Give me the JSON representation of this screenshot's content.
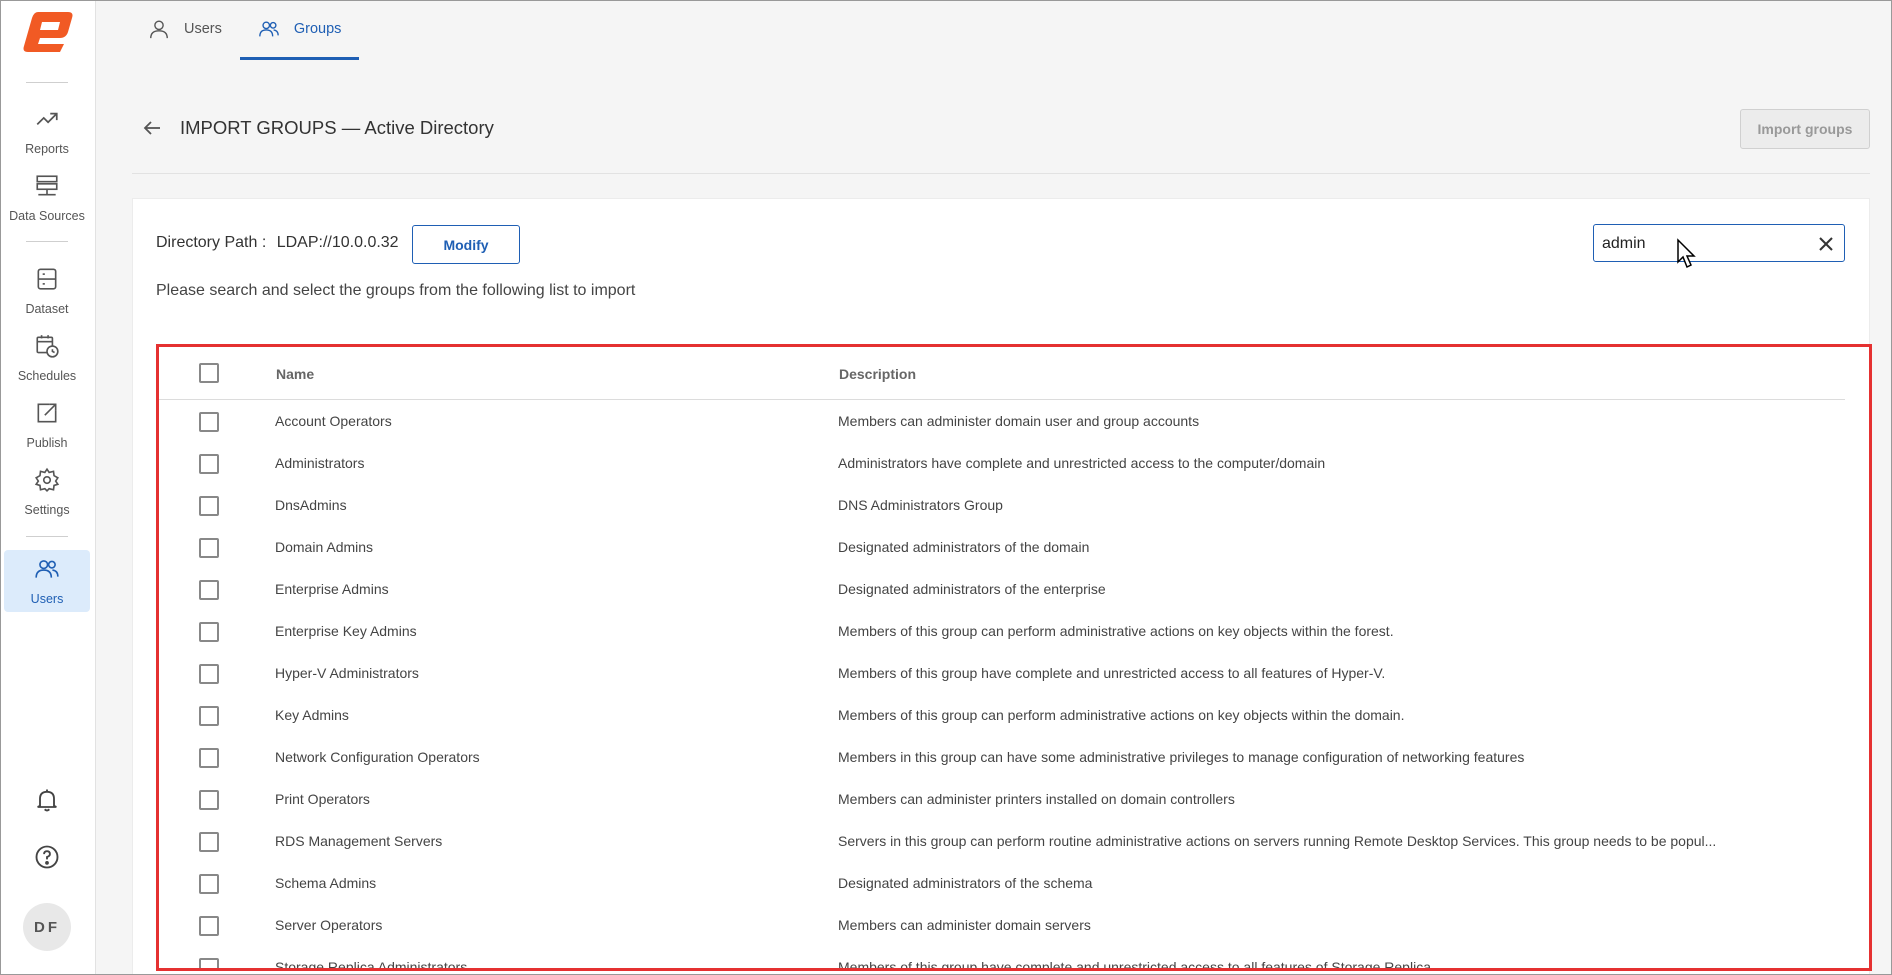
{
  "sidebar": {
    "items": [
      {
        "label": "Reports"
      },
      {
        "label": "Data Sources"
      },
      {
        "label": "Dataset"
      },
      {
        "label": "Schedules"
      },
      {
        "label": "Publish"
      },
      {
        "label": "Settings"
      },
      {
        "label": "Users"
      }
    ],
    "avatar_initials": "DF"
  },
  "tabs": [
    {
      "label": "Users"
    },
    {
      "label": "Groups"
    }
  ],
  "header": {
    "title": "IMPORT GROUPS — Active Directory",
    "import_button": "Import groups"
  },
  "directory": {
    "label": "Directory Path :",
    "value": "LDAP://10.0.0.32",
    "modify_button": "Modify"
  },
  "hint": "Please search and select the groups from the following list to import",
  "search": {
    "value": "admin"
  },
  "table": {
    "columns": [
      "Name",
      "Description"
    ],
    "rows": [
      {
        "name": "Account Operators",
        "description": "Members can administer domain user and group accounts"
      },
      {
        "name": "Administrators",
        "description": "Administrators have complete and unrestricted access to the computer/domain"
      },
      {
        "name": "DnsAdmins",
        "description": "DNS Administrators Group"
      },
      {
        "name": "Domain Admins",
        "description": "Designated administrators of the domain"
      },
      {
        "name": "Enterprise Admins",
        "description": "Designated administrators of the enterprise"
      },
      {
        "name": "Enterprise Key Admins",
        "description": "Members of this group can perform administrative actions on key objects within the forest."
      },
      {
        "name": "Hyper-V Administrators",
        "description": "Members of this group have complete and unrestricted access to all features of Hyper-V."
      },
      {
        "name": "Key Admins",
        "description": "Members of this group can perform administrative actions on key objects within the domain."
      },
      {
        "name": "Network Configuration Operators",
        "description": "Members in this group can have some administrative privileges to manage configuration of networking features"
      },
      {
        "name": "Print Operators",
        "description": "Members can administer printers installed on domain controllers"
      },
      {
        "name": "RDS Management Servers",
        "description": "Servers in this group can perform routine administrative actions on servers running Remote Desktop Services. This group needs to be popul..."
      },
      {
        "name": "Schema Admins",
        "description": "Designated administrators of the schema"
      },
      {
        "name": "Server Operators",
        "description": "Members can administer domain servers"
      },
      {
        "name": "Storage Replica Administrators",
        "description": "Members of this group have complete and unrestricted access to all features of Storage Replica."
      }
    ]
  },
  "colors": {
    "accent": "#1f5fb4",
    "logo": "#f15a24",
    "highlight_border": "#e53131"
  }
}
